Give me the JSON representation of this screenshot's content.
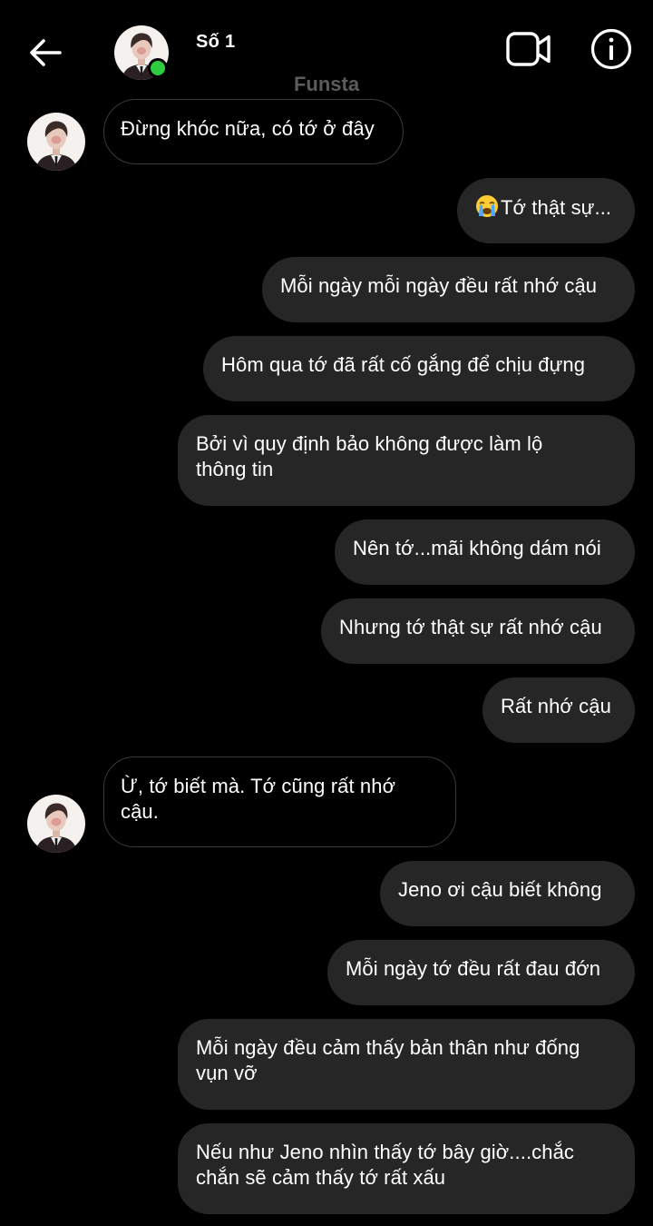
{
  "header": {
    "contact_name": "Số 1",
    "account_label": "Funsta",
    "online": true
  },
  "messages": [
    {
      "id": "m1",
      "direction": "in",
      "text": "Đừng khóc nữa, có tớ ở đây"
    },
    {
      "id": "m2",
      "direction": "out",
      "emoji": "crying-face-emoji",
      "text": "Tớ thật sự..."
    },
    {
      "id": "m3",
      "direction": "out",
      "text": "Mỗi ngày mỗi ngày đều rất nhớ cậu"
    },
    {
      "id": "m4",
      "direction": "out",
      "text": "Hôm qua tớ đã rất cố gắng để chịu đựng"
    },
    {
      "id": "m5",
      "direction": "out",
      "line1": "Bởi vì quy định bảo không được làm lộ",
      "line2": "thông tin"
    },
    {
      "id": "m6",
      "direction": "out",
      "text": "Nên tớ...mãi không dám nói"
    },
    {
      "id": "m7",
      "direction": "out",
      "text": "Nhưng tớ thật sự rất nhớ cậu"
    },
    {
      "id": "m8",
      "direction": "out",
      "text": "Rất nhớ cậu"
    },
    {
      "id": "m9",
      "direction": "in",
      "line1": "Ừ, tớ biết mà. Tớ cũng rất nhớ",
      "line2": "cậu."
    },
    {
      "id": "m10",
      "direction": "out",
      "text": "Jeno ơi cậu biết không"
    },
    {
      "id": "m11",
      "direction": "out",
      "text": "Mỗi ngày tớ đều rất đau đớn"
    },
    {
      "id": "m12",
      "direction": "out",
      "line1": "Mỗi ngày đều cảm thấy bản thân như đống",
      "line2": "vụn vỡ"
    },
    {
      "id": "m13",
      "direction": "out",
      "line1": "Nếu như Jeno nhìn thấy tớ bây giờ....chắc",
      "line2": "chắn sẽ cảm thấy tớ rất xấu"
    }
  ],
  "colors": {
    "background": "#000000",
    "outgoing_bubble": "#262626",
    "incoming_border": "#3a3a3a",
    "online_dot": "#2ecc40",
    "account_label": "#5c5c5c"
  }
}
